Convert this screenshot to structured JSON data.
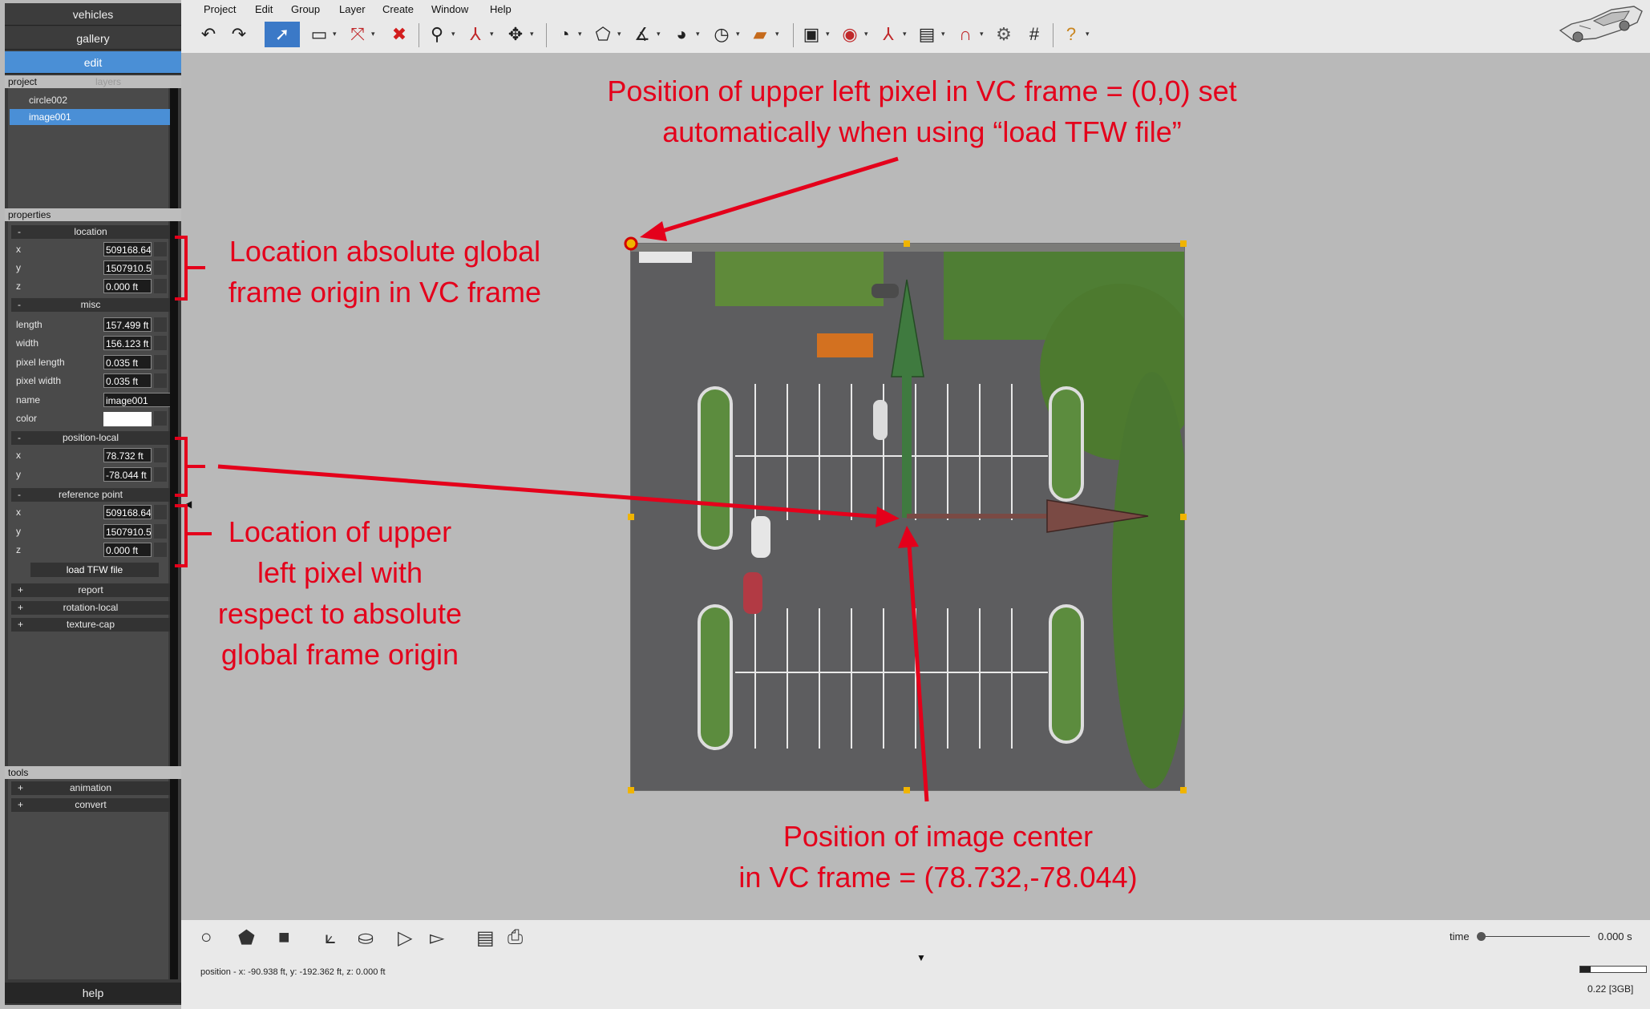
{
  "sidebar": {
    "nav": {
      "vehicles": "vehicles",
      "gallery": "gallery",
      "edit": "edit"
    },
    "tabs": {
      "project": "project",
      "layers": "layers"
    },
    "project_items": [
      {
        "label": "circle002"
      },
      {
        "label": "image001"
      }
    ],
    "properties_label": "properties",
    "sections": {
      "location": {
        "toggle": "-",
        "title": "location"
      },
      "misc": {
        "toggle": "-",
        "title": "misc"
      },
      "position_local": {
        "toggle": "-",
        "title": "position-local"
      },
      "reference_point": {
        "toggle": "-",
        "title": "reference point"
      },
      "report": {
        "toggle": "+",
        "title": "report"
      },
      "rotation_local": {
        "toggle": "+",
        "title": "rotation-local"
      },
      "texture_cap": {
        "toggle": "+",
        "title": "texture-cap"
      }
    },
    "location": {
      "x_label": "x",
      "x": "509168.64",
      "y_label": "y",
      "y": "1507910.5",
      "z_label": "z",
      "z": "0.000 ft"
    },
    "misc": {
      "length_label": "length",
      "length": "157.499 ft",
      "width_label": "width",
      "width": "156.123 ft",
      "pixel_length_label": "pixel length",
      "pixel_length": "0.035 ft",
      "pixel_width_label": "pixel width",
      "pixel_width": "0.035 ft",
      "name_label": "name",
      "name": "image001",
      "color_label": "color",
      "color": "#ffffff"
    },
    "position_local": {
      "x_label": "x",
      "x": "78.732 ft",
      "y_label": "y",
      "y": "-78.044 ft"
    },
    "reference_point": {
      "x_label": "x",
      "x": "509168.64",
      "y_label": "y",
      "y": "1507910.5",
      "z_label": "z",
      "z": "0.000 ft"
    },
    "load_tfw": "load TFW file",
    "tools_label": "tools",
    "tools_sections": {
      "animation": {
        "toggle": "+",
        "title": "animation"
      },
      "convert": {
        "toggle": "+",
        "title": "convert"
      }
    },
    "help": "help"
  },
  "menu": [
    "Project",
    "Edit",
    "Group",
    "Layer",
    "Create",
    "Window",
    "Help"
  ],
  "toolbar_icons": [
    "undo-icon",
    "redo-icon",
    "select-arrow-icon",
    "select-rectangle-icon",
    "split-icon",
    "delete-icon",
    "zoom-icon",
    "axes-icon",
    "move-icon",
    "measure-angle-icon",
    "measure-area-icon",
    "measure-length-icon",
    "gauge-icon",
    "dial-icon",
    "ruler-icon",
    "snapshot-icon",
    "target-icon",
    "frame-icon",
    "camera-view-icon",
    "magnet-icon",
    "gear-icon",
    "grid-icon",
    "help-icon"
  ],
  "annotations": {
    "top_line1": "Position of upper left pixel in VC frame = (0,0) set",
    "top_line2": "automatically when using “load TFW file”",
    "loc_line1": "Location absolute global",
    "loc_line2": "frame origin in VC frame",
    "ref_line1": "Location of upper",
    "ref_line2": "left pixel with",
    "ref_line3": "respect to absolute",
    "ref_line4": "global frame origin",
    "center_line1": "Position of image center",
    "center_line2": "in VC frame = (78.732,-78.044)"
  },
  "colors": {
    "annotation": "#e4001b",
    "accent": "#4a8fd6",
    "y_axis": "#3f7a3f",
    "x_axis": "#7a4a44"
  },
  "status": {
    "position": "position - x: -90.938 ft, y: -192.362 ft, z: 0.000 ft",
    "time_label": "time",
    "time_value": "0.000 s",
    "time_fraction": 0,
    "memory": "0.22 [3GB]",
    "memory_fraction": 0.16
  }
}
